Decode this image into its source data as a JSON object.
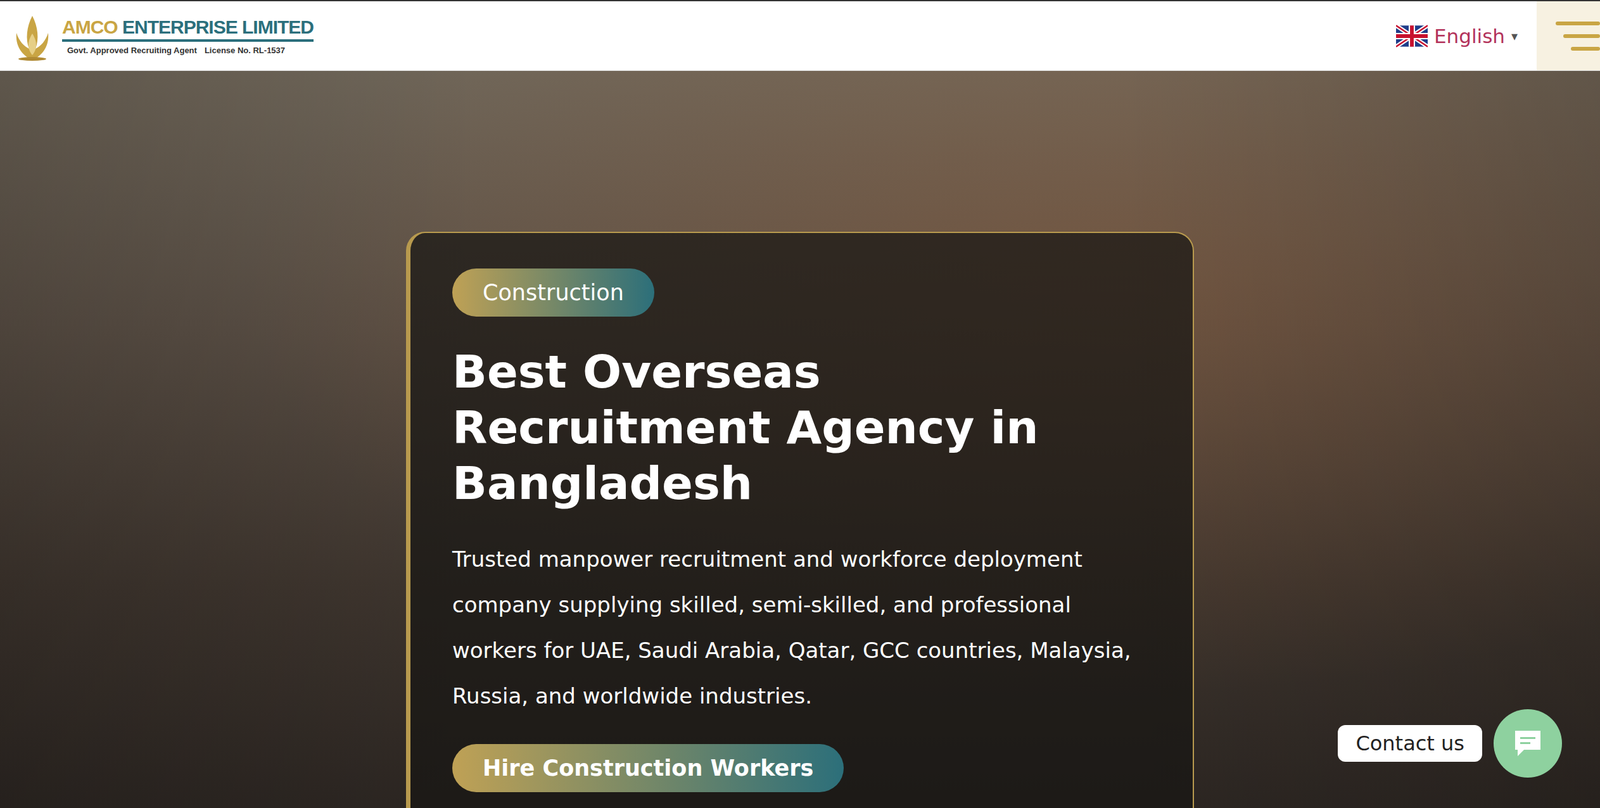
{
  "header": {
    "brand": {
      "name_a": "AMCO",
      "name_b": "ENTERPRISE LIMITED",
      "tagline": "Govt. Approved Recruiting Agent",
      "license": "License No. RL-1537"
    },
    "language": {
      "label": "English",
      "caret": "▾"
    }
  },
  "hero": {
    "badge": "Construction",
    "title": "Best Overseas Recruitment Agency in Bangladesh",
    "description": "Trusted manpower recruitment and workforce deployment company supplying skilled, semi-skilled, and professional workers for UAE, Saudi Arabia, Qatar, GCC countries, Malaysia, Russia, and worldwide industries.",
    "button": "Hire Construction Workers"
  },
  "contact": {
    "label": "Contact us"
  }
}
